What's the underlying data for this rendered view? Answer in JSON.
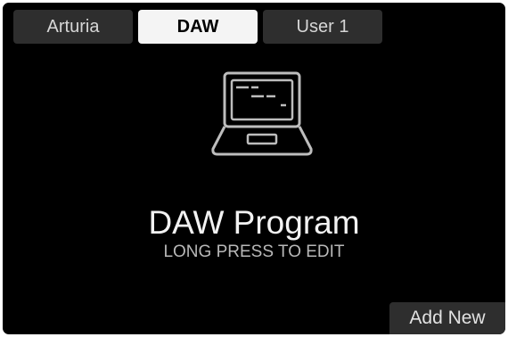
{
  "tabs": [
    {
      "label": "Arturia"
    },
    {
      "label": "DAW"
    },
    {
      "label": "User 1"
    }
  ],
  "main": {
    "icon": "laptop-icon",
    "title": "DAW Program",
    "hint": "LONG PRESS TO EDIT"
  },
  "actions": {
    "add_new_label": "Add New"
  },
  "colors": {
    "background": "#000000",
    "active_tab": "#f4f4f4",
    "inactive_tab": "#2e2e2e",
    "text_primary": "#f2f2f2",
    "text_secondary": "#b8b8b8",
    "icon_stroke": "#bdbdbd"
  }
}
